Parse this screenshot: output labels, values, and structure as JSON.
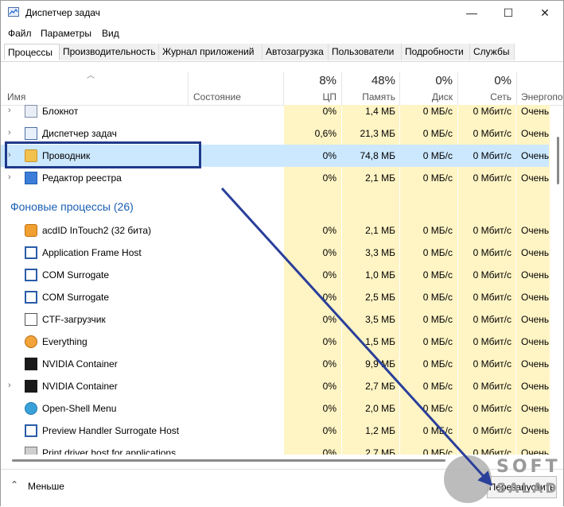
{
  "window": {
    "title": "Диспетчер задач",
    "minimize_glyph": "—",
    "maximize_glyph": "☐",
    "close_glyph": "✕"
  },
  "menu": [
    "Файл",
    "Параметры",
    "Вид"
  ],
  "tabs": [
    "Процессы",
    "Производительность",
    "Журнал приложений",
    "Автозагрузка",
    "Пользователи",
    "Подробности",
    "Службы"
  ],
  "columns": {
    "name": "Имя",
    "status": "Состояние",
    "cpu_pct": "8%",
    "cpu": "ЦП",
    "mem_pct": "48%",
    "mem": "Память",
    "disk_pct": "0%",
    "disk": "Диск",
    "net_pct": "0%",
    "net": "Сеть",
    "power": "Энергопо"
  },
  "apps": [
    {
      "name": "Блокнот",
      "cpu": "0%",
      "mem": "1,4 МБ",
      "disk": "0 МБ/с",
      "net": "0 Мбит/с",
      "power": "Очень",
      "icon": "notepad-icon"
    },
    {
      "name": "Диспетчер задач",
      "cpu": "0,6%",
      "mem": "21,3 МБ",
      "disk": "0 МБ/с",
      "net": "0 Мбит/с",
      "power": "Очень",
      "icon": "task-manager-icon"
    },
    {
      "name": "Проводник",
      "cpu": "0%",
      "mem": "74,8 МБ",
      "disk": "0 МБ/с",
      "net": "0 Мбит/с",
      "power": "Очень",
      "icon": "folder-icon"
    },
    {
      "name": "Редактор реестра",
      "cpu": "0%",
      "mem": "2,1 МБ",
      "disk": "0 МБ/с",
      "net": "0 Мбит/с",
      "power": "Очень",
      "icon": "registry-icon"
    }
  ],
  "background_group": "Фоновые процессы (26)",
  "background": [
    {
      "name": "acdID InTouch2 (32 бита)",
      "cpu": "0%",
      "mem": "2,1 МБ",
      "disk": "0 МБ/с",
      "net": "0 Мбит/с",
      "power": "Очень",
      "icon": "acdsee-icon"
    },
    {
      "name": "Application Frame Host",
      "cpu": "0%",
      "mem": "3,3 МБ",
      "disk": "0 МБ/с",
      "net": "0 Мбит/с",
      "power": "Очень",
      "icon": "app-frame-icon"
    },
    {
      "name": "COM Surrogate",
      "cpu": "0%",
      "mem": "1,0 МБ",
      "disk": "0 МБ/с",
      "net": "0 Мбит/с",
      "power": "Очень",
      "icon": "app-frame-icon"
    },
    {
      "name": "COM Surrogate",
      "cpu": "0%",
      "mem": "2,5 МБ",
      "disk": "0 МБ/с",
      "net": "0 Мбит/с",
      "power": "Очень",
      "icon": "app-frame-icon"
    },
    {
      "name": "CTF-загрузчик",
      "cpu": "0%",
      "mem": "3,5 МБ",
      "disk": "0 МБ/с",
      "net": "0 Мбит/с",
      "power": "Очень",
      "icon": "ctf-icon"
    },
    {
      "name": "Everything",
      "cpu": "0%",
      "mem": "1,5 МБ",
      "disk": "0 МБ/с",
      "net": "0 Мбит/с",
      "power": "Очень",
      "icon": "everything-icon"
    },
    {
      "name": "NVIDIA Container",
      "cpu": "0%",
      "mem": "9,9 МБ",
      "disk": "0 МБ/с",
      "net": "0 Мбит/с",
      "power": "Очень",
      "icon": "nvidia-icon"
    },
    {
      "name": "NVIDIA Container",
      "cpu": "0%",
      "mem": "2,7 МБ",
      "disk": "0 МБ/с",
      "net": "0 Мбит/с",
      "power": "Очень",
      "icon": "nvidia-icon"
    },
    {
      "name": "Open-Shell Menu",
      "cpu": "0%",
      "mem": "2,0 МБ",
      "disk": "0 МБ/с",
      "net": "0 Мбит/с",
      "power": "Очень",
      "icon": "shell-icon"
    },
    {
      "name": "Preview Handler Surrogate Host",
      "cpu": "0%",
      "mem": "1,2 МБ",
      "disk": "0 МБ/с",
      "net": "0 Мбит/с",
      "power": "Очень",
      "icon": "app-frame-icon"
    },
    {
      "name": "Print driver host for applications",
      "cpu": "0%",
      "mem": "2,7 МБ",
      "disk": "0 МБ/с",
      "net": "0 Мбит/с",
      "power": "Очень",
      "icon": "printer-icon"
    }
  ],
  "footer": {
    "less_glyph": "⌃",
    "less": "Меньше",
    "restart": "Перезапустить"
  },
  "watermark": {
    "line1": "SOFT",
    "line2": "SALAD"
  },
  "colors": {
    "accent": "#1a5fb4",
    "selection": "#cce8ff",
    "highlight_box": "#1f3a8a",
    "arrow": "#2a3f9a",
    "col_yellow": "#fff4c4"
  }
}
